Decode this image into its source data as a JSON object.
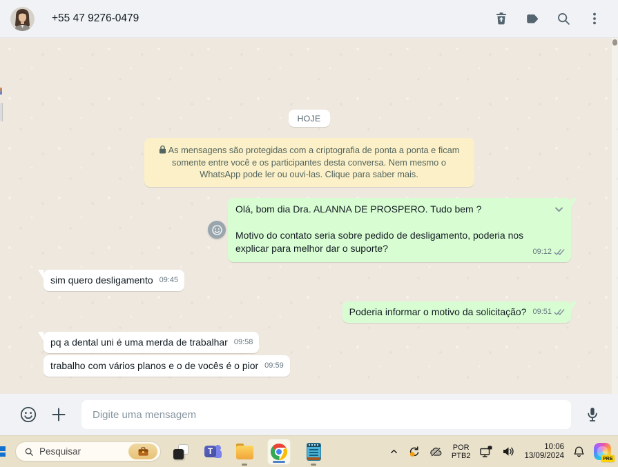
{
  "header": {
    "phone_number": "+55 47 9276-0479",
    "action_icons": [
      "delete-trash",
      "label-tag",
      "search",
      "menu-kebab"
    ]
  },
  "chat": {
    "date_badge": "HOJE",
    "encryption_notice": "As mensagens são protegidas com a criptografia de ponta a ponta e ficam somente entre você e os participantes desta conversa. Nem mesmo o WhatsApp pode ler ou ouvi-las. Clique para saber mais.",
    "messages": [
      {
        "direction": "out",
        "text": "Olá, bom dia Dra. ALANNA DE PROSPERO. Tudo bem ?\n\nMotivo do contato seria sobre pedido de desligamento, poderia nos explicar para melhor dar o suporte?",
        "time": "09:12",
        "status": "delivered"
      },
      {
        "direction": "in",
        "text": "sim quero desligamento",
        "time": "09:45"
      },
      {
        "direction": "out",
        "text": "Poderia informar o motivo da solicitação?",
        "time": "09:51",
        "status": "delivered"
      },
      {
        "direction": "in",
        "text": "pq a dental uni é uma merda de trabalhar",
        "time": "09:58"
      },
      {
        "direction": "in",
        "text": "trabalho com vários planos e o de vocês é o pior",
        "time": "09:59"
      }
    ]
  },
  "composer": {
    "placeholder": "Digite uma mensagem",
    "icons": [
      "emoji-smiley",
      "attach-plus",
      "microphone"
    ]
  },
  "taskbar": {
    "search_placeholder": "Pesquisar",
    "app_icons": [
      "desktop-preview",
      "teams",
      "file-explorer",
      "chrome-active",
      "notepad"
    ],
    "tray_icons": [
      "chevron-up",
      "sync",
      "cloud-paused",
      "network-ethernet",
      "volume",
      "bell",
      "copilot"
    ],
    "language": {
      "line1": "POR",
      "line2": "PTB2"
    },
    "clock": {
      "time": "10:06",
      "date": "13/09/2024"
    },
    "copilot_badge": "PRE"
  },
  "colors": {
    "outgoing_bubble": "#d9fdd3",
    "incoming_bubble": "#ffffff",
    "wallpaper": "#efe8df",
    "header_bg": "#f0f2f5",
    "banner_bg": "#fbf0c7",
    "taskbar_bg": "#e9e1ca",
    "check_delivered": "#8696a0",
    "chrome_active_indicator": "#4e82c8"
  }
}
